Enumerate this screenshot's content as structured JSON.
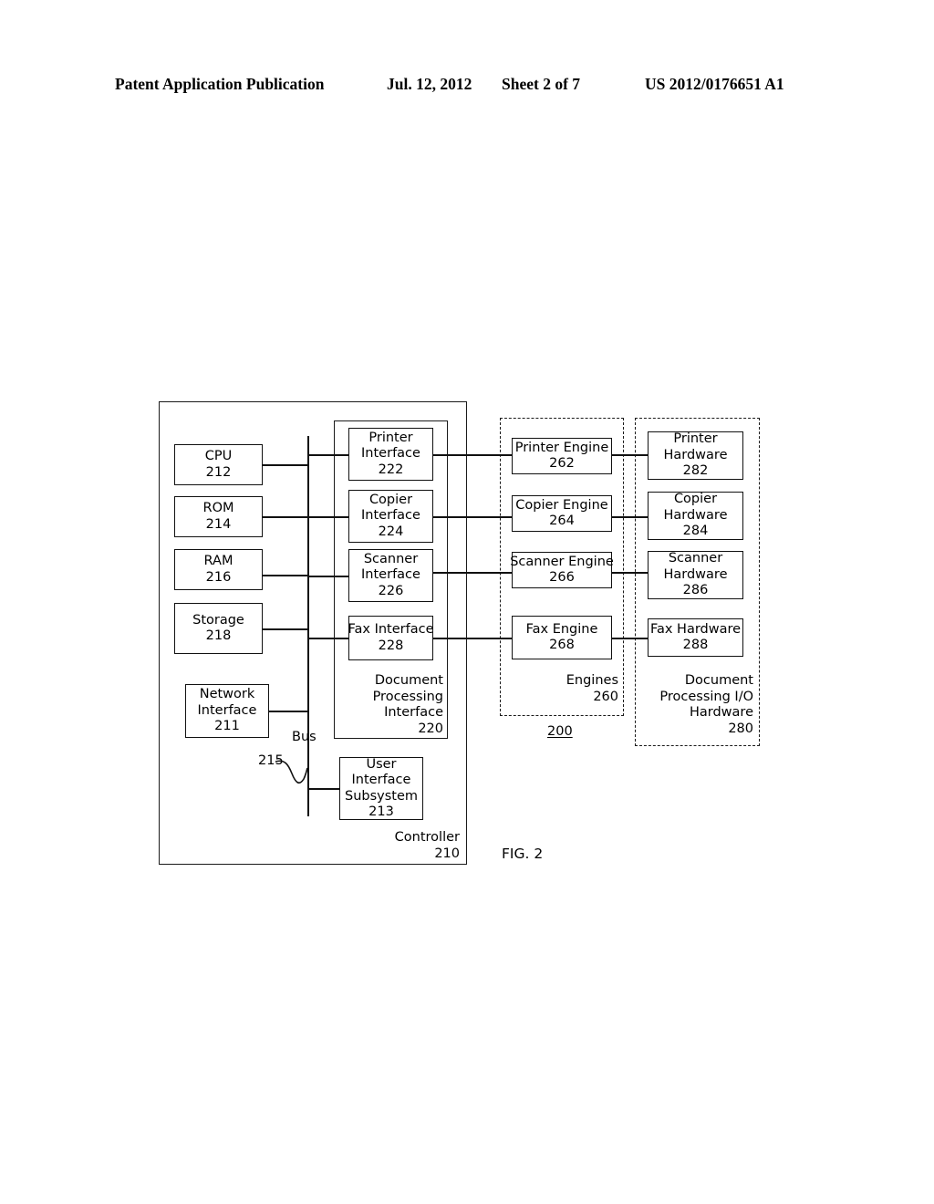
{
  "header": {
    "publication": "Patent Application Publication",
    "date": "Jul. 12, 2012",
    "sheet": "Sheet 2 of 7",
    "number": "US 2012/0176651 A1"
  },
  "figure": {
    "label": "FIG. 2",
    "system_ref": "200",
    "bus_label": "Bus",
    "bus_ref": "215"
  },
  "containers": {
    "controller": {
      "name": "Controller",
      "ref": "210"
    },
    "document_processing_interface": {
      "name_line1": "Document",
      "name_line2": "Processing",
      "name_line3": "Interface",
      "ref": "220"
    },
    "engines": {
      "name": "Engines",
      "ref": "260"
    },
    "document_processing_io_hardware": {
      "name_line1": "Document",
      "name_line2": "Processing I/O",
      "name_line3": "Hardware",
      "ref": "280"
    }
  },
  "nodes": {
    "cpu": {
      "line1": "CPU",
      "ref": "212"
    },
    "rom": {
      "line1": "ROM",
      "ref": "214"
    },
    "ram": {
      "line1": "RAM",
      "ref": "216"
    },
    "storage": {
      "line1": "Storage",
      "ref": "218"
    },
    "network_interface": {
      "line1": "Network",
      "line2": "Interface",
      "ref": "211"
    },
    "user_interface_subsystem": {
      "line1": "User",
      "line2": "Interface",
      "line3": "Subsystem",
      "ref": "213"
    },
    "printer_interface": {
      "line1": "Printer",
      "line2": "Interface",
      "ref": "222"
    },
    "copier_interface": {
      "line1": "Copier",
      "line2": "Interface",
      "ref": "224"
    },
    "scanner_interface": {
      "line1": "Scanner",
      "line2": "Interface",
      "ref": "226"
    },
    "fax_interface": {
      "line1": "Fax Interface",
      "ref": "228"
    },
    "printer_engine": {
      "line1": "Printer Engine",
      "ref": "262"
    },
    "copier_engine": {
      "line1": "Copier Engine",
      "ref": "264"
    },
    "scanner_engine": {
      "line1": "Scanner Engine",
      "ref": "266"
    },
    "fax_engine": {
      "line1": "Fax Engine",
      "ref": "268"
    },
    "printer_hardware": {
      "line1": "Printer",
      "line2": "Hardware",
      "ref": "282"
    },
    "copier_hardware": {
      "line1": "Copier",
      "line2": "Hardware",
      "ref": "284"
    },
    "scanner_hardware": {
      "line1": "Scanner",
      "line2": "Hardware",
      "ref": "286"
    },
    "fax_hardware": {
      "line1": "Fax Hardware",
      "ref": "288"
    }
  }
}
